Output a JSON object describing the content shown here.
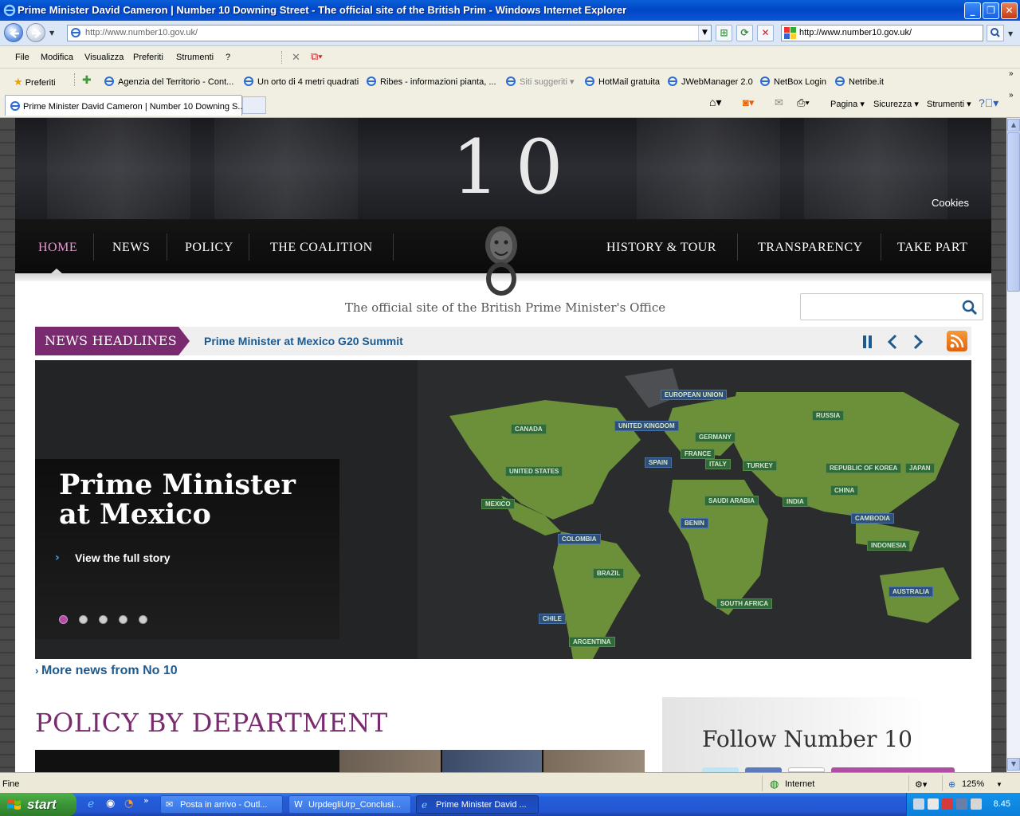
{
  "window": {
    "title": "Prime Minister David Cameron | Number 10 Downing Street - The official site of the British Prim - Windows Internet Explorer",
    "controls": {
      "minimize": "_",
      "maximize": "❐",
      "close": "✕"
    }
  },
  "addressbar": {
    "url": "http://www.number10.gov.uk/",
    "search_value": "http://www.number10.gov.uk/"
  },
  "menu": [
    "File",
    "Modifica",
    "Visualizza",
    "Preferiti",
    "Strumenti",
    "?"
  ],
  "favorites": {
    "label": "Preferiti",
    "items": [
      "Agenzia del Territorio - Cont...",
      "Un orto di 4 metri quadrati",
      "Ribes - informazioni pianta, ...",
      "Siti suggeriti",
      "HotMail gratuita",
      "JWebManager 2.0",
      "NetBox  Login",
      "Netribe.it"
    ]
  },
  "tabs": {
    "active": "Prime Minister David Cameron | Number 10 Downing S..."
  },
  "commandbar": [
    "Pagina",
    "Sicurezza",
    "Strumenti"
  ],
  "site": {
    "logo": "10",
    "cookies": "Cookies",
    "nav_left": [
      "HOME",
      "NEWS",
      "POLICY",
      "THE COALITION"
    ],
    "nav_right": [
      "HISTORY & TOUR",
      "TRANSPARENCY",
      "TAKE PART"
    ],
    "tagline": "The official site of the British Prime Minister's Office",
    "headlines_label": "NEWS HEADLINES",
    "headline": "Prime Minister at Mexico G20 Summit",
    "hero_title": "Prime Minister at Mexico",
    "hero_link": "View the full story",
    "hero_slide_count": 5,
    "hero_active_slide": 1,
    "more_news": "More news from No 10",
    "policy_heading": "POLICY BY DEPARTMENT",
    "follow_title": "Follow Number 10",
    "map_labels": [
      "EUROPEAN UNION",
      "RUSSIA",
      "CANADA",
      "UNITED KINGDOM",
      "GERMANY",
      "FRANCE",
      "SPAIN",
      "ITALY",
      "TURKEY",
      "REPUBLIC OF KOREA",
      "JAPAN",
      "UNITED STATES",
      "CHINA",
      "MEXICO",
      "SAUDI ARABIA",
      "INDIA",
      "BENIN",
      "CAMBODIA",
      "INDONESIA",
      "COLOMBIA",
      "BRAZIL",
      "SOUTH AFRICA",
      "AUSTRALIA",
      "CHILE",
      "ARGENTINA"
    ]
  },
  "status": {
    "text": "Fine",
    "zone": "Internet",
    "zoom": "125%"
  },
  "taskbar": {
    "start": "start",
    "tasks": [
      "Posta in arrivo - Outl...",
      "UrpdegliUrp_Conclusi...",
      "Prime Minister David ..."
    ],
    "clock": "8.45"
  },
  "colors": {
    "brand_purple": "#7a2b6f",
    "link_blue": "#1e5a8e",
    "nav_active": "#e59ad0"
  }
}
